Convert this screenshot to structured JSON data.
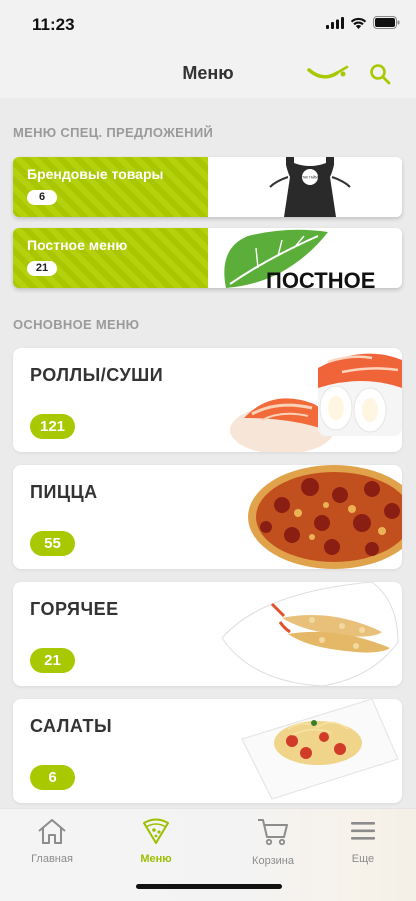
{
  "status_bar": {
    "time": "11:23"
  },
  "nav": {
    "title": "Меню"
  },
  "special": {
    "heading": "МЕНЮ СПЕЦ. ПРЕДЛОЖЕНИЙ",
    "items": [
      {
        "label": "Брендовые товары",
        "count": "6",
        "apron_text": "ТАК ТАЙМ"
      },
      {
        "label": "Постное меню",
        "count": "21",
        "image_text": "ПОСТНОЕ"
      }
    ]
  },
  "main": {
    "heading": "ОСНОВНОЕ МЕНЮ",
    "items": [
      {
        "label": "РОЛЛЫ/СУШИ",
        "count": "121"
      },
      {
        "label": "ПИЦЦА",
        "count": "55"
      },
      {
        "label": "ГОРЯЧЕЕ",
        "count": "21"
      },
      {
        "label": "САЛАТЫ",
        "count": "6"
      }
    ]
  },
  "tabs": [
    {
      "label": "Главная",
      "icon": "home-icon"
    },
    {
      "label": "Меню",
      "icon": "pizza-slice-icon",
      "active": true
    },
    {
      "label": "Корзина",
      "icon": "cart-icon"
    },
    {
      "label": "Еще",
      "icon": "hamburger-menu-icon"
    }
  ],
  "colors": {
    "accent": "#a8c800",
    "tab_active": "#9cbf00",
    "background": "#ebebeb"
  }
}
